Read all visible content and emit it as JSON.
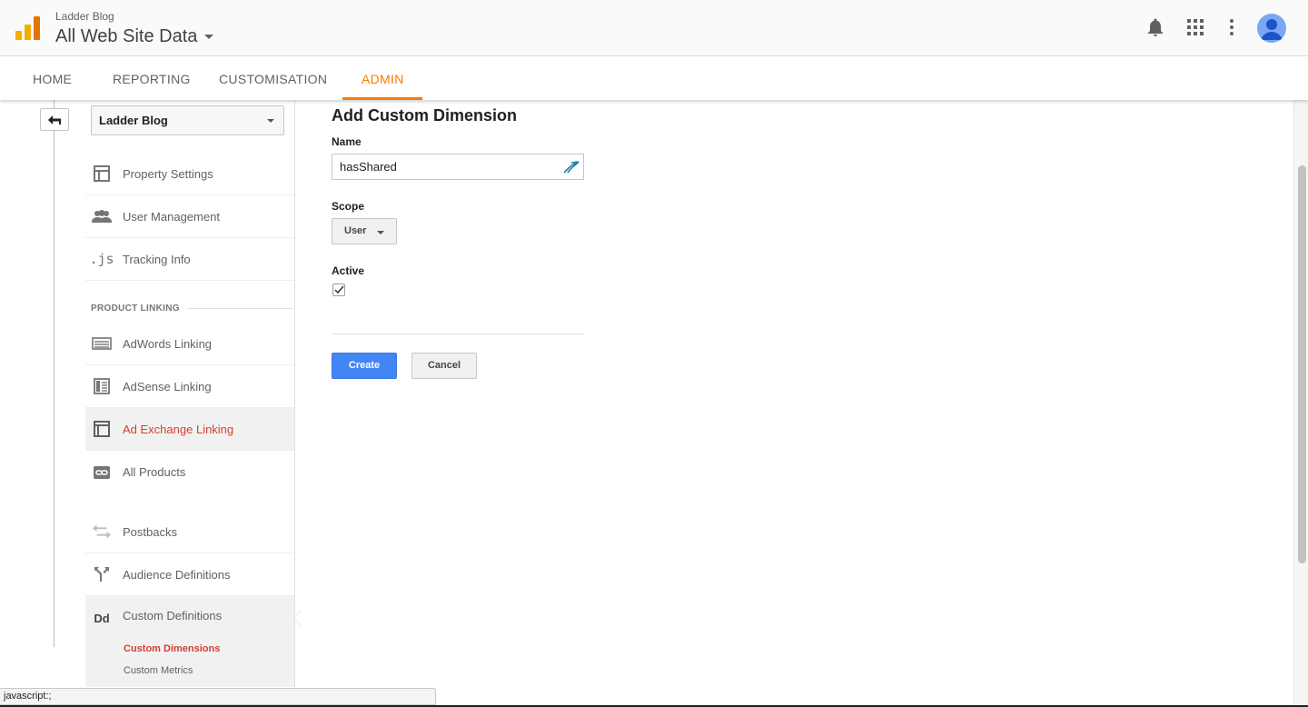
{
  "header": {
    "account_name": "Ladder Blog",
    "view_name": "All Web Site Data"
  },
  "nav": {
    "tabs": [
      {
        "label": "HOME"
      },
      {
        "label": "REPORTING"
      },
      {
        "label": "CUSTOMISATION"
      },
      {
        "label": "ADMIN",
        "active": true
      }
    ]
  },
  "sidebar": {
    "property_selector": "Ladder Blog",
    "items": [
      {
        "label": "Property Settings",
        "icon": "property-settings-icon"
      },
      {
        "label": "User Management",
        "icon": "users-icon"
      },
      {
        "label": "Tracking Info",
        "icon": "js-icon"
      }
    ],
    "section_label": "PRODUCT LINKING",
    "linking_items": [
      {
        "label": "AdWords Linking",
        "icon": "adwords-icon"
      },
      {
        "label": "AdSense Linking",
        "icon": "adsense-icon"
      },
      {
        "label": "Ad Exchange Linking",
        "icon": "ad-exchange-icon"
      },
      {
        "label": "All Products",
        "icon": "link-icon"
      }
    ],
    "other_items": [
      {
        "label": "Postbacks",
        "icon": "postbacks-icon"
      },
      {
        "label": "Audience Definitions",
        "icon": "audience-icon"
      },
      {
        "label": "Custom Definitions",
        "icon": "dd-icon",
        "icon_text": "Dd"
      }
    ],
    "sub_items": [
      {
        "label": "Custom Dimensions",
        "active": true
      },
      {
        "label": "Custom Metrics"
      }
    ]
  },
  "form": {
    "title": "Add Custom Dimension",
    "name_label": "Name",
    "name_value": "hasShared",
    "scope_label": "Scope",
    "scope_value": "User",
    "active_label": "Active",
    "active_checked": true,
    "create_label": "Create",
    "cancel_label": "Cancel"
  },
  "status_bar": {
    "text": "javascript:;"
  },
  "colors": {
    "accent_orange": "#f57c00",
    "active_red": "#d23f31",
    "primary_blue": "#4285f4"
  }
}
